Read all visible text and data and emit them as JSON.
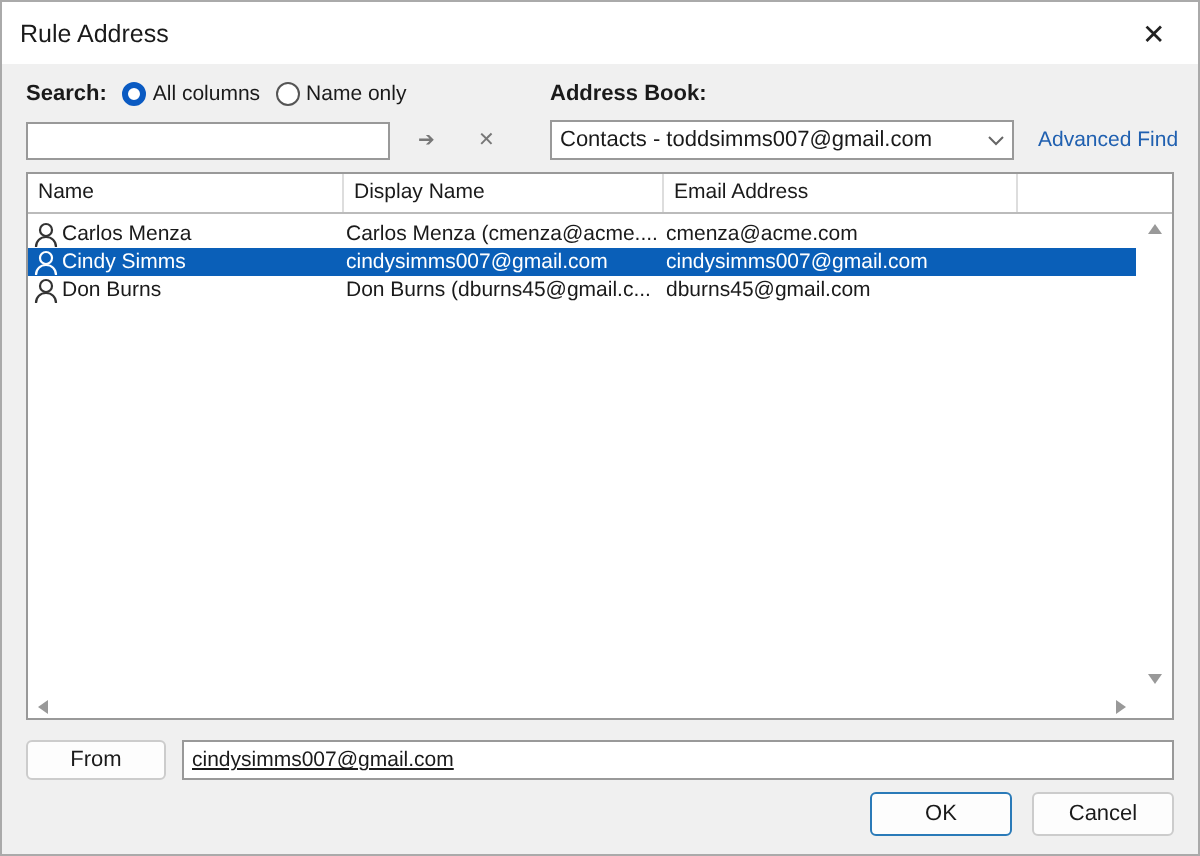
{
  "window": {
    "title": "Rule Address",
    "close": "✕"
  },
  "search": {
    "label": "Search:",
    "options": [
      {
        "label": "All columns",
        "selected": true
      },
      {
        "label": "Name only",
        "selected": false
      }
    ],
    "go": "➔",
    "clear": "✕"
  },
  "address_book": {
    "label": "Address Book:",
    "value": "Contacts - toddsimms007@gmail.com",
    "advanced_find": "Advanced Find"
  },
  "table": {
    "columns": [
      "Name",
      "Display Name",
      "Email Address"
    ],
    "rows": [
      {
        "name": "Carlos Menza",
        "display_name": "Carlos Menza (cmenza@acme....",
        "email": "cmenza@acme.com",
        "selected": false
      },
      {
        "name": "Cindy Simms",
        "display_name": "cindysimms007@gmail.com",
        "email": "cindysimms007@gmail.com",
        "selected": true
      },
      {
        "name": "Don Burns",
        "display_name": "Don Burns (dburns45@gmail.c...",
        "email": "dburns45@gmail.com",
        "selected": false
      }
    ]
  },
  "from": {
    "button": "From",
    "value": "cindysimms007@gmail.com"
  },
  "buttons": [
    "OK",
    "Cancel"
  ]
}
